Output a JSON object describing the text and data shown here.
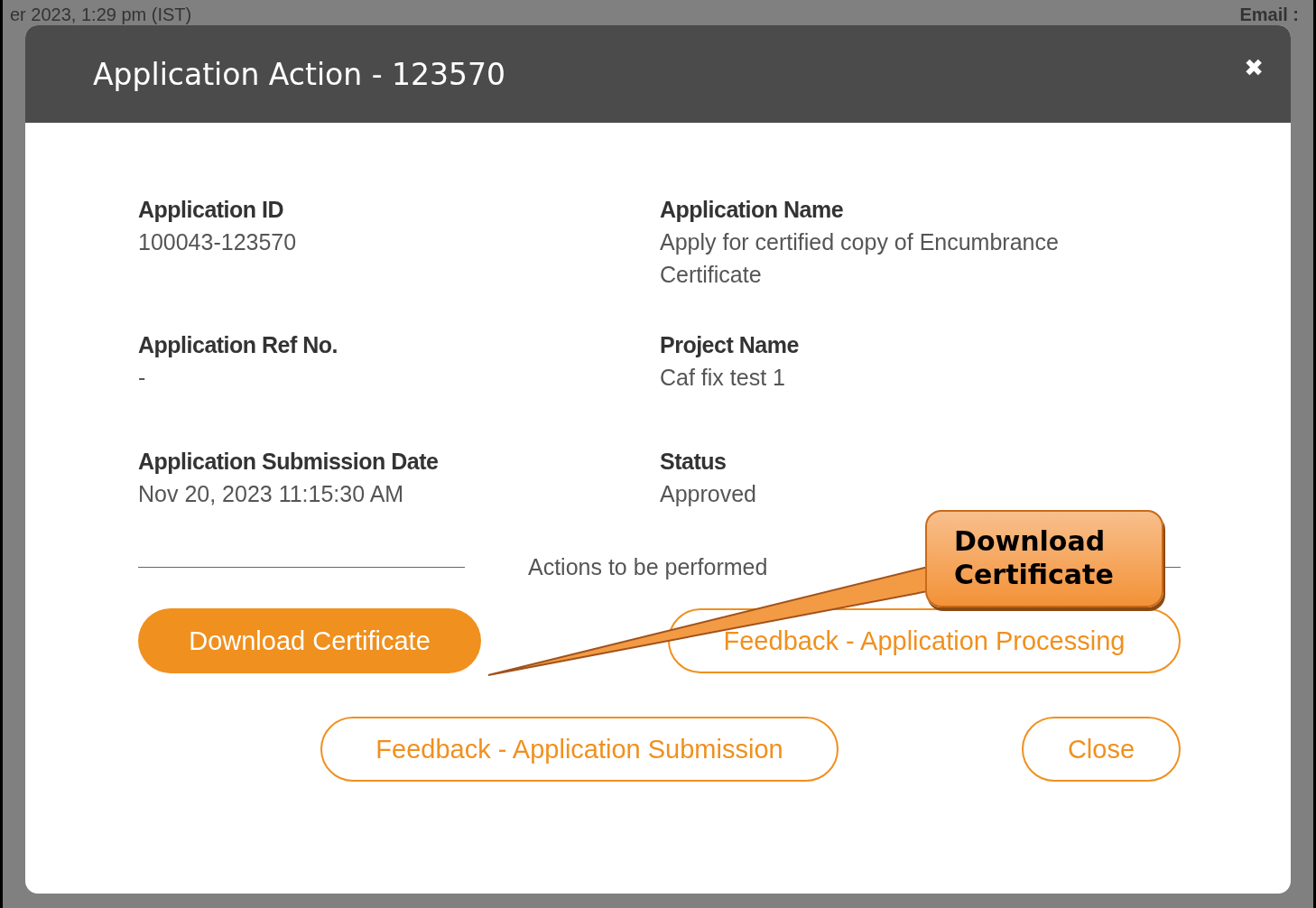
{
  "background": {
    "texts": [
      "er 2023, 1:29 pm (IST)",
      "Email :"
    ]
  },
  "dialog": {
    "title": "Application Action - 123570",
    "close": "✖",
    "fields": [
      {
        "label": "Application ID",
        "value": "100043-123570"
      },
      {
        "label": "Application Name",
        "value": "Apply for certified copy of Encumbrance Certificate"
      },
      {
        "label": "Application Ref No.",
        "value": "-"
      },
      {
        "label": "Project Name",
        "value": "Caf fix test 1"
      },
      {
        "label": "Application Submission Date",
        "value": "Nov 20, 2023 11:15:30 AM"
      },
      {
        "label": "Status",
        "value": "Approved"
      }
    ],
    "actions_heading": "Actions to be performed",
    "buttons": [
      {
        "label": "Download Certificate",
        "kind": "filled"
      },
      {
        "label": "Feedback - Application Processing",
        "kind": "outline"
      },
      {
        "label": "Feedback - Application Submission",
        "kind": "outline"
      },
      {
        "label": "Close",
        "kind": "outline"
      }
    ]
  },
  "callout": {
    "text": "Download Certificate"
  }
}
